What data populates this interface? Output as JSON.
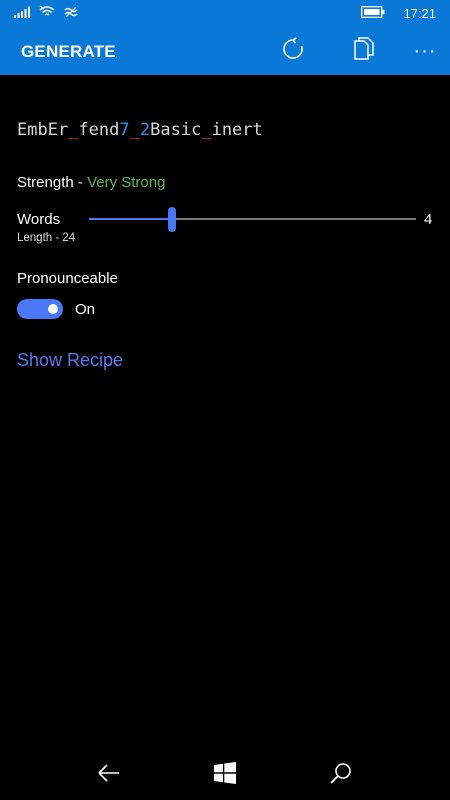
{
  "status_bar": {
    "time": "17:21",
    "icons": [
      "signal-icon",
      "wifi-icon",
      "data-icon",
      "battery-icon"
    ]
  },
  "app_bar": {
    "title": "GENERATE",
    "actions": [
      "refresh-icon",
      "copy-icon",
      "more-icon"
    ],
    "more_label": "···"
  },
  "password": {
    "segments": [
      {
        "text": "EmbEr",
        "kind": "word"
      },
      {
        "text": "_",
        "kind": "separator"
      },
      {
        "text": "fend",
        "kind": "word"
      },
      {
        "text": "7",
        "kind": "number"
      },
      {
        "text": "_",
        "kind": "separator"
      },
      {
        "text": "2",
        "kind": "number"
      },
      {
        "text": "Basic",
        "kind": "word"
      },
      {
        "text": "_",
        "kind": "separator"
      },
      {
        "text": "inert",
        "kind": "word"
      }
    ]
  },
  "strength": {
    "label": "Strength",
    "dash": " - ",
    "value": "Very Strong",
    "value_color": "#5cb85c"
  },
  "words": {
    "label": "Words",
    "length_text": "Length - 24",
    "slider_value": "4",
    "slider_fraction": 0.255
  },
  "pronounceable": {
    "label": "Pronounceable",
    "state_label": "On",
    "enabled": true
  },
  "show_recipe": "Show Recipe",
  "colors": {
    "accent": "#4a78f5",
    "app_bar": "#0a78d7",
    "separator": "#e2541e",
    "number": "#2f8fe6"
  },
  "nav_bar": [
    "back-icon",
    "windows-start-icon",
    "search-icon"
  ]
}
